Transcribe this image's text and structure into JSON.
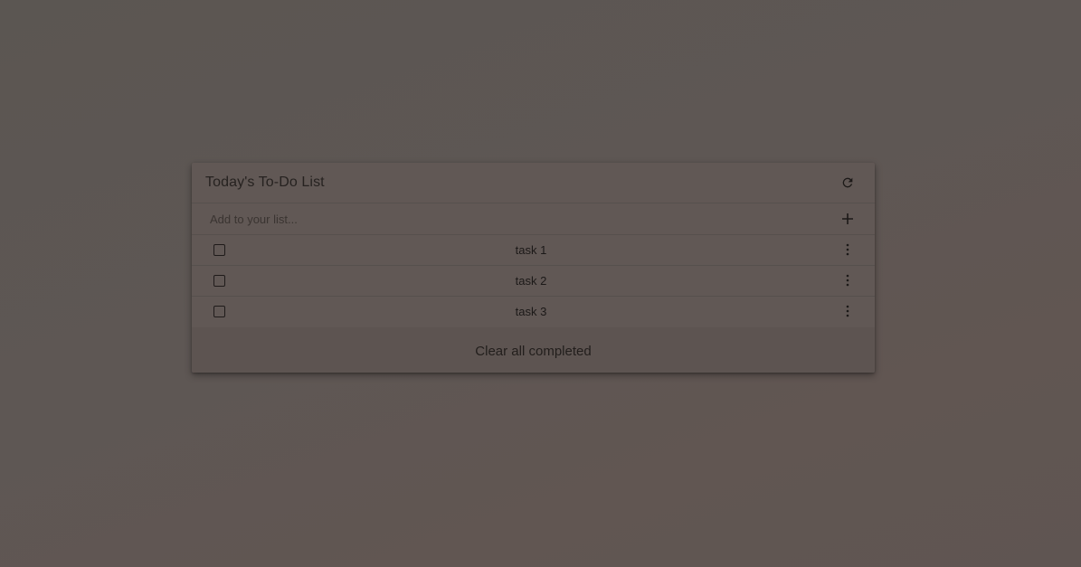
{
  "todo": {
    "title": "Today's To-Do List",
    "refresh_icon": "refresh-icon",
    "input": {
      "placeholder": "Add to your list...",
      "value": ""
    },
    "add_icon": "plus-icon",
    "tasks": [
      {
        "label": "task 1",
        "checked": false
      },
      {
        "label": "task 2",
        "checked": false
      },
      {
        "label": "task 3",
        "checked": false
      }
    ],
    "menu_icon": "more-vertical-icon",
    "clear_label": "Clear all completed"
  },
  "colors": {
    "background": "#5e5754",
    "card": "#615855",
    "text": "#1c1918"
  }
}
